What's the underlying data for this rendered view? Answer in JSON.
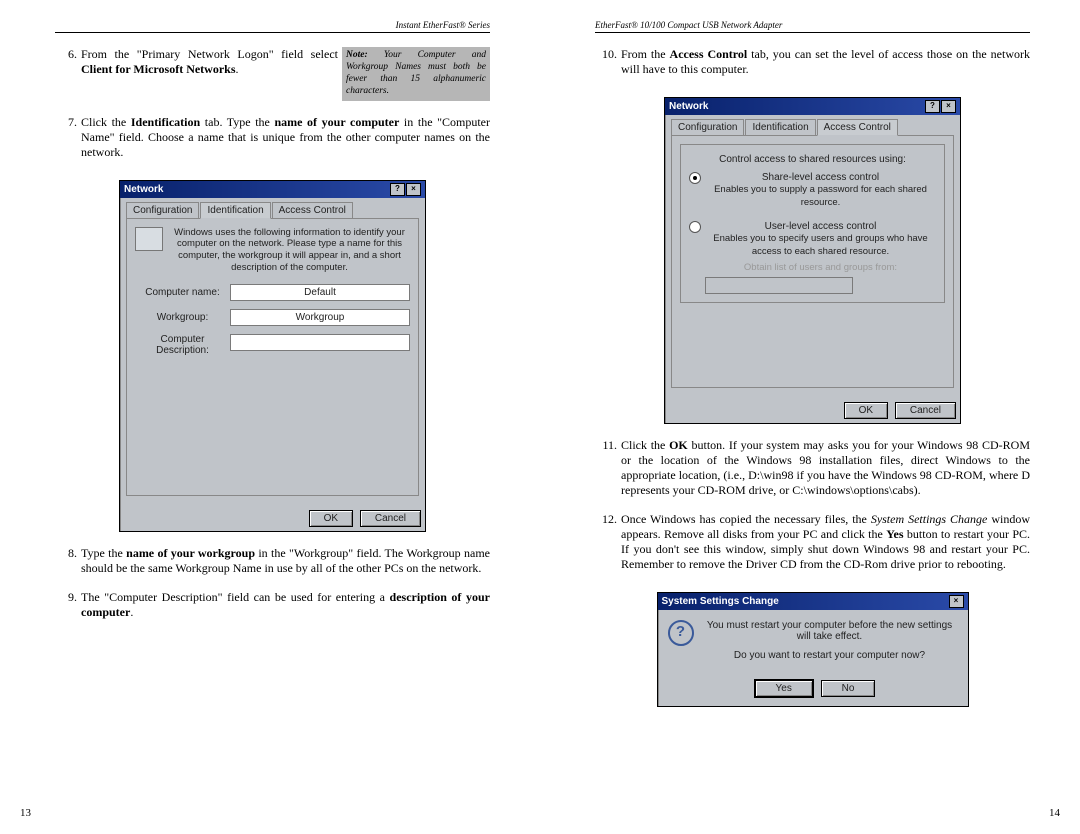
{
  "left": {
    "header": "Instant EtherFast® Series",
    "page_number": "13",
    "note": {
      "label": "Note:",
      "text": "Your Computer and Workgroup Names must both be fewer than 15 alphanumeric characters."
    },
    "step6": {
      "num": "6.",
      "pre": "From the \"Primary Network Logon\" field select ",
      "bold": "Client for Microsoft Networks",
      "post": "."
    },
    "step7": {
      "num": "7.",
      "t1": "Click the ",
      "b1": "Identification",
      "t2": " tab. Type the ",
      "b2": "name of your computer",
      "t3": " in the \"Computer Name\" field. Choose a name that is unique from the other computer names on the network."
    },
    "step8": {
      "num": "8.",
      "t1": "Type the ",
      "b1": "name of your workgroup",
      "t2": " in the \"Workgroup\" field. The Workgroup name should be the same Workgroup Name in use by all of the other PCs on the network."
    },
    "step9": {
      "num": "9.",
      "t1": "The \"Computer Description\" field can be used for entering a ",
      "b1": "description of your computer",
      "t2": "."
    },
    "dlg1": {
      "title": "Network",
      "help": "?",
      "close": "×",
      "tab_config": "Configuration",
      "tab_ident": "Identification",
      "tab_access": "Access Control",
      "info": "Windows uses the following information to identify your computer on the network. Please type a name for this computer, the workgroup it will appear in, and a short description of the computer.",
      "l_cname": "Computer name:",
      "v_cname": "Default",
      "l_wg": "Workgroup:",
      "v_wg": "Workgroup",
      "l_desc": "Computer Description:",
      "v_desc": "",
      "ok": "OK",
      "cancel": "Cancel"
    }
  },
  "right": {
    "header": "EtherFast® 10/100 Compact USB Network Adapter",
    "page_number": "14",
    "step10": {
      "num": "10.",
      "t1": "From the ",
      "b1": "Access Control",
      "t2": " tab, you can set the level of access those on the network will have to this computer."
    },
    "step11": {
      "num": "11.",
      "t1": "Click the ",
      "b1": "OK",
      "t2": " button. If your system may asks you for your Windows 98 CD-ROM or the location of the Windows 98 installation files, direct Windows to the appropriate location, (i.e., D:\\win98 if you have the Windows 98 CD-ROM, where D represents your CD-ROM drive, or C:\\windows\\options\\cabs)."
    },
    "step12": {
      "num": "12.",
      "t1": "Once Windows has copied the necessary files, the ",
      "i1": "System Settings Change",
      "t2": " window appears. Remove all disks from your PC and click the ",
      "b1": "Yes",
      "t3": " button to restart your PC. If you don't see this window, simply shut down Windows 98 and restart your PC. Remember to remove the Driver CD from the CD-Rom drive prior to rebooting."
    },
    "dlg2": {
      "title": "Network",
      "help": "?",
      "close": "×",
      "tab_config": "Configuration",
      "tab_ident": "Identification",
      "tab_access": "Access Control",
      "group_label": "Control access to shared resources using:",
      "r1": "Share-level access control",
      "r1_desc": "Enables you to supply a password for each shared resource.",
      "r2": "User-level access control",
      "r2_desc": "Enables you to specify users and groups who have access to each shared resource.",
      "r2_sub": "Obtain list of users and groups from:",
      "ok": "OK",
      "cancel": "Cancel"
    },
    "ssc": {
      "title": "System Settings Change",
      "close": "×",
      "msg1": "You must restart your computer before the new settings will take effect.",
      "msg2": "Do you want to restart your computer now?",
      "yes": "Yes",
      "no": "No",
      "q": "?"
    }
  }
}
